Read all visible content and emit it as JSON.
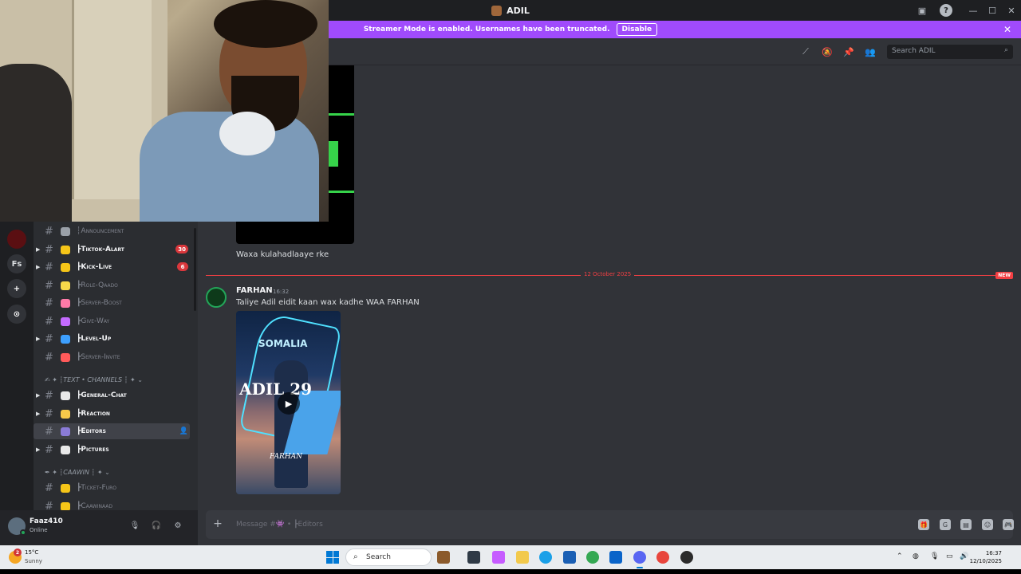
{
  "window": {
    "title": "ADIL",
    "minimize_icon": "minimize-icon",
    "maximize_icon": "maximize-icon",
    "close_icon": "close-icon"
  },
  "streamer_banner": {
    "message": "Streamer Mode is enabled. Usernames have been truncated.",
    "disable_label": "Disable",
    "color": "#a04bfc"
  },
  "rail": {
    "server_initials": "Fs",
    "add_icon": "+",
    "discover_icon": "⊙"
  },
  "channels": [
    {
      "key": "announcement",
      "name": "┆Announcement",
      "emoji_color": "#9aa0a8",
      "state": "muted",
      "arrow": false,
      "badge": ""
    },
    {
      "key": "tiktok",
      "name": "┣Tiktok-Alart",
      "emoji_color": "#f5c518",
      "state": "unread",
      "arrow": true,
      "badge": "30"
    },
    {
      "key": "kick",
      "name": "┣Kick-Live",
      "emoji_color": "#f5c518",
      "state": "unread",
      "arrow": true,
      "badge": "6"
    },
    {
      "key": "roleqaado",
      "name": "┣Role-Qaado",
      "emoji_color": "#f7d84a",
      "state": "muted",
      "arrow": false,
      "badge": ""
    },
    {
      "key": "boost",
      "name": "┣Server-Boost",
      "emoji_color": "#ff7aa8",
      "state": "muted",
      "arrow": false,
      "badge": ""
    },
    {
      "key": "giveway",
      "name": "┣Give-Way",
      "emoji_color": "#c46bff",
      "state": "muted",
      "arrow": false,
      "badge": ""
    },
    {
      "key": "levelup",
      "name": "┣Level-Up",
      "emoji_color": "#3da0ff",
      "state": "unread",
      "arrow": true,
      "badge": ""
    },
    {
      "key": "invite",
      "name": "┣Server-Invite",
      "emoji_color": "#ff5a5a",
      "state": "muted",
      "arrow": false,
      "badge": ""
    },
    {
      "key": "general",
      "name": "┣General-Chat",
      "emoji_color": "#e8e8e8",
      "state": "unread",
      "arrow": true,
      "badge": ""
    },
    {
      "key": "reaction",
      "name": "┣Reaction",
      "emoji_color": "#f7c84a",
      "state": "unread",
      "arrow": true,
      "badge": ""
    },
    {
      "key": "editors",
      "name": "┣Editors",
      "emoji_color": "#8a7bd8",
      "state": "active",
      "arrow": false,
      "badge": ""
    },
    {
      "key": "pictures",
      "name": "┣Pictures",
      "emoji_color": "#e8e8e8",
      "state": "unread",
      "arrow": true,
      "badge": ""
    },
    {
      "key": "ticket",
      "name": "┣Ticket-Furo",
      "emoji_color": "#f5c518",
      "state": "muted",
      "arrow": false,
      "badge": ""
    },
    {
      "key": "caawinaad",
      "name": "┣Caawinaad",
      "emoji_color": "#f5c518",
      "state": "muted",
      "arrow": false,
      "badge": ""
    }
  ],
  "categories": {
    "text_channels": "✍ ✦ ┆TEXT • CHANNELS ┆ ✦ ⌄",
    "caawin": "✒ ✦ ┆CAAWIN ┆ ✦ ⌄"
  },
  "user": {
    "name": "Faaz410",
    "status": "Online",
    "mic_icon": "🎙",
    "headphone_icon": "🎧",
    "settings_icon": "⚙"
  },
  "header": {
    "search_placeholder": "Search ADIL"
  },
  "chat": {
    "prev_message": "Waxa kulahadlaaye rke",
    "divider_date": "12 October 2025",
    "new_label": "NEW",
    "author": "FARHAN",
    "time": "16:32",
    "message": "Taliye Adil eidit kaan wax kadhe  WAA FARHAN",
    "video_title": "SOMALIA",
    "video_name": "ADIL 29",
    "video_caption": "FARHAN",
    "composer_placeholder": "Message #👾 • ┣Editors"
  },
  "taskbar": {
    "temperature": "15°C",
    "condition": "Sunny",
    "weather_badge": "2",
    "search_label": "Search",
    "time": "16:37",
    "date": "12/10/2025"
  }
}
